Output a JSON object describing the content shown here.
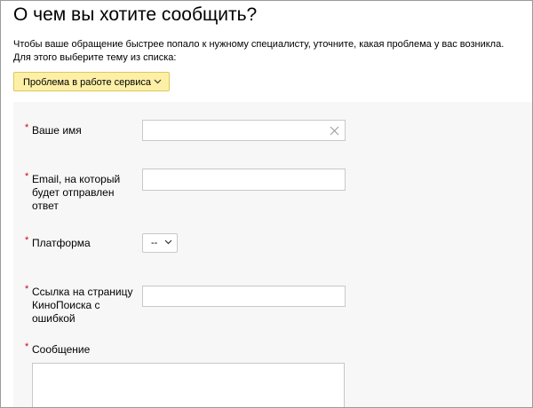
{
  "page": {
    "title": "О чем вы хотите сообщить?",
    "description_line1": "Чтобы ваше обращение быстрее попало к нужному специалисту, уточните, какая проблема у вас возникла.",
    "description_line2": "Для этого выберите тему из списка:"
  },
  "topic_selector": {
    "label": "Проблема в работе сервиса",
    "icon": "chevron-down-icon"
  },
  "form": {
    "required_mark": "*",
    "fields": {
      "name": {
        "label": "Ваше имя",
        "value": "",
        "clear_icon": "close-icon"
      },
      "email": {
        "label_lines": [
          "Email, на который",
          "будет отправлен",
          "ответ"
        ],
        "value": ""
      },
      "platform": {
        "label": "Платформа",
        "selected": "--",
        "icon": "chevron-down-icon"
      },
      "link": {
        "label_lines": [
          "Ссылка на страницу",
          "КиноПоиска с",
          "ошибкой"
        ],
        "value": ""
      },
      "message": {
        "label": "Сообщение",
        "value": ""
      }
    }
  },
  "colors": {
    "required": "#d0021b",
    "topic_button_bg": "#fdf0a6",
    "form_bg": "#f7f7f7"
  }
}
